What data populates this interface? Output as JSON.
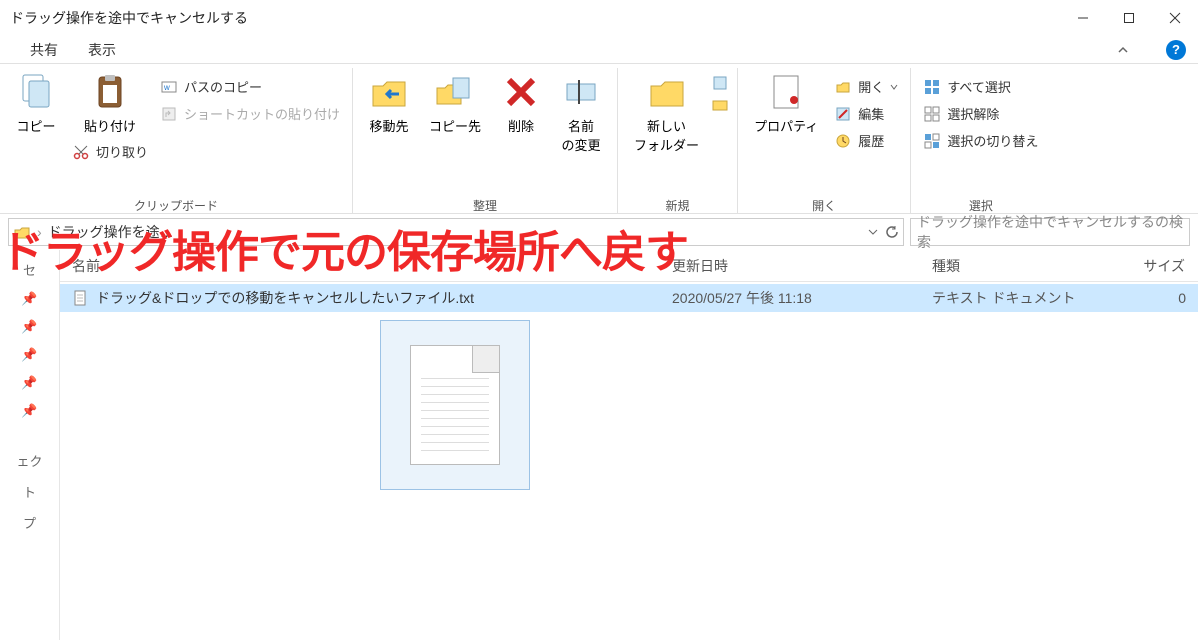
{
  "title": "ドラッグ操作を途中でキャンセルする",
  "tabs": {
    "share": "共有",
    "view": "表示"
  },
  "ribbon": {
    "clipboard": {
      "copy": "コピー",
      "paste": "貼り付け",
      "cut": "切り取り",
      "copy_path": "パスのコピー",
      "paste_shortcut": "ショートカットの貼り付け",
      "group": "クリップボード"
    },
    "organize": {
      "move_to": "移動先",
      "copy_to": "コピー先",
      "delete": "削除",
      "rename": "名前\nの変更",
      "group": "整理"
    },
    "new": {
      "new_folder": "新しい\nフォルダー",
      "group": "新規"
    },
    "open": {
      "properties": "プロパティ",
      "open": "開く",
      "edit": "編集",
      "history": "履歴",
      "group": "開く"
    },
    "select": {
      "select_all": "すべて選択",
      "select_none": "選択解除",
      "invert": "選択の切り替え",
      "group": "選択"
    }
  },
  "address": {
    "crumb": "ドラッグ操作を途…",
    "full": "ドラッグ操作を途中でキャンセルするの検索"
  },
  "columns": {
    "name": "名前",
    "date": "更新日時",
    "type": "種類",
    "size": "サイズ"
  },
  "file": {
    "name": "ドラッグ&ドロップでの移動をキャンセルしたいファイル.txt",
    "date": "2020/05/27 午後 11:18",
    "type": "テキスト ドキュメント",
    "size": "0"
  },
  "nav": {
    "quick": "セ",
    "obj1": "ェク",
    "obj2": "ト",
    "obj3": "プ"
  },
  "annotation": "ドラッグ操作で元の保存場所へ戻す"
}
